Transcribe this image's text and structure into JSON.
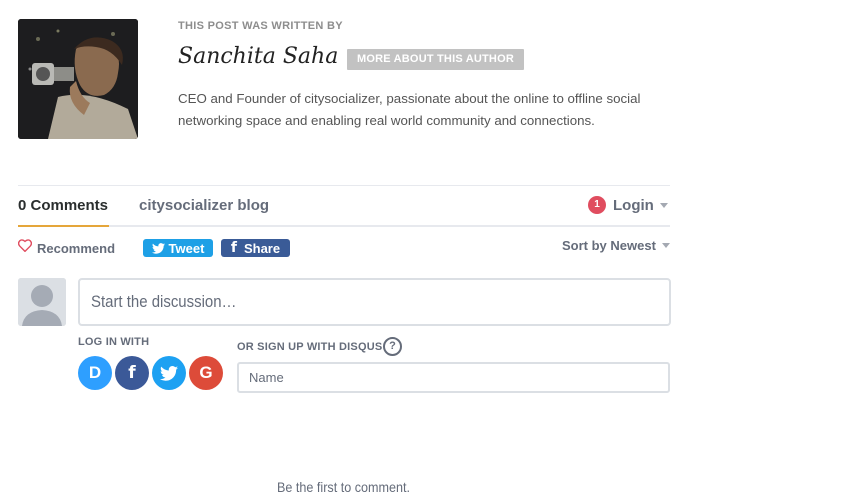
{
  "author": {
    "written_by": "THIS POST WAS WRITTEN BY",
    "name": "Sanchita Saha",
    "more_button": "MORE ABOUT THIS AUTHOR",
    "bio": "CEO and Founder of citysocializer, passionate about the online to offline social networking space and enabling real world community and connections."
  },
  "comments": {
    "tabs": [
      "0 Comments",
      "citysocializer blog"
    ],
    "login": {
      "badge": "1",
      "label": "Login"
    },
    "recommend_label": "Recommend",
    "tweet_label": "Tweet",
    "share_label": "Share",
    "sort_label": "Sort by Newest",
    "discussion_placeholder": "Start the discussion…",
    "login_with": "LOG IN WITH",
    "social_icons": [
      {
        "name": "disqus",
        "letter": "D",
        "color": "#2e9fff"
      },
      {
        "name": "facebook",
        "letter": "f",
        "color": "#3b5998"
      },
      {
        "name": "twitter",
        "letter": "",
        "color": "#1da1f2"
      },
      {
        "name": "google",
        "letter": "G",
        "color": "#dd4b39"
      }
    ],
    "signup_label": "OR SIGN UP WITH DISQUS",
    "help_symbol": "?",
    "name_placeholder": "Name",
    "empty_message": "Be the first to comment."
  },
  "colors": {
    "accent_underline": "#e5a63a",
    "badge": "#e04d5f",
    "tweet": "#1ea0e6",
    "share": "#3a5b97"
  }
}
